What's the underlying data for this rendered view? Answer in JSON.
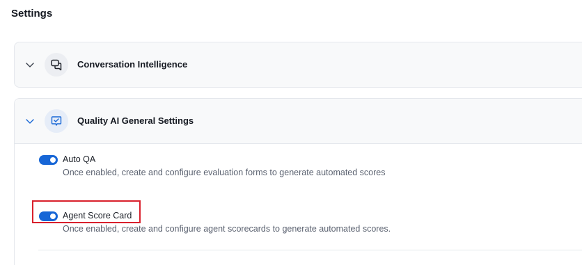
{
  "page": {
    "title": "Settings"
  },
  "sections": [
    {
      "title": "Conversation Intelligence",
      "icon": "chat-bubbles-icon",
      "expanded": false
    },
    {
      "title": "Quality AI General Settings",
      "icon": "checkmark-message-icon",
      "expanded": true,
      "settings": [
        {
          "label": "Auto QA",
          "description": "Once enabled, create and configure evaluation forms to generate automated scores",
          "enabled": true
        },
        {
          "label": "Agent Score Card",
          "description": "Once enabled, create and configure agent scorecards to generate automated scores.",
          "enabled": true,
          "highlighted": true
        }
      ]
    }
  ],
  "colors": {
    "toggle_on": "#1766d6",
    "highlight": "#d9202c",
    "panel_header_bg": "#f8f9fa"
  }
}
